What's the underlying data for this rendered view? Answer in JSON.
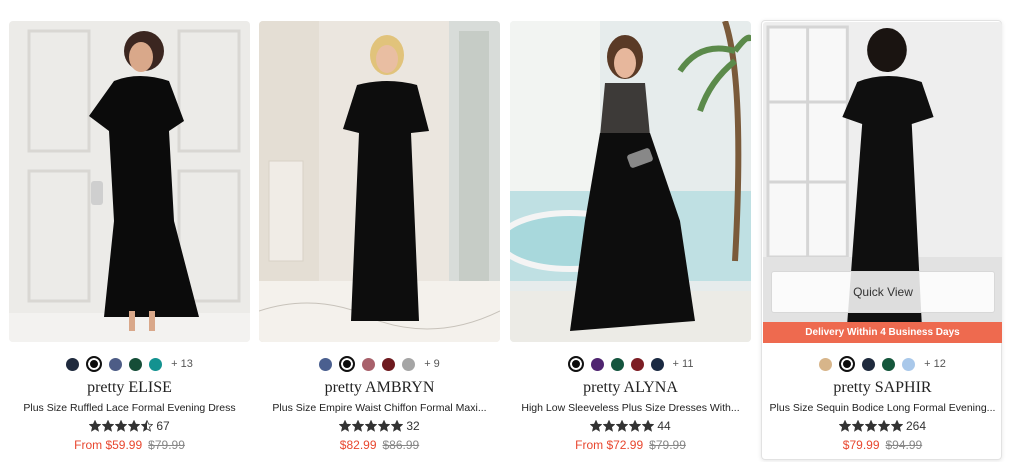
{
  "products": [
    {
      "brand": "pretty ELISE",
      "name": "Plus Size Ruffled Lace Formal Evening Dress",
      "rating": 4.5,
      "reviews": "67",
      "price": "From $59.99",
      "original_price": "$79.99",
      "swatches": [
        "#1f2a3d",
        "#0b0b0b",
        "#4d5c86",
        "#154d37",
        "#139290"
      ],
      "selected_swatch": 1,
      "more_colors": "+ 13",
      "image": {
        "dress_color": "#0b0b0b",
        "background": "#eceae7"
      }
    },
    {
      "brand": "pretty AMBRYN",
      "name": "Plus Size Empire Waist Chiffon Formal Maxi...",
      "rating": 5,
      "reviews": "32",
      "price": "$82.99",
      "original_price": "$86.99",
      "swatches": [
        "#4a5f8f",
        "#0b0b0b",
        "#a8616b",
        "#6e1a1f",
        "#a5a5a5"
      ],
      "selected_swatch": 1,
      "more_colors": "+ 9",
      "image": {
        "dress_color": "#0d0d0d",
        "background": "#ebe6df"
      }
    },
    {
      "brand": "pretty ALYNA",
      "name": "High Low Sleeveless Plus Size Dresses With...",
      "rating": 5,
      "reviews": "44",
      "price": "From $72.99",
      "original_price": "$79.99",
      "swatches": [
        "#0b0b0b",
        "#4f2470",
        "#14553e",
        "#7c1d24",
        "#1b2a42"
      ],
      "selected_swatch": 0,
      "more_colors": "+ 11",
      "image": {
        "dress_color": "#0d0d0d",
        "background": "#dfe9ea"
      }
    },
    {
      "brand": "pretty SAPHIR",
      "name": "Plus Size Sequin Bodice Long Formal Evening...",
      "rating": 5,
      "reviews": "264",
      "price": "$79.99",
      "original_price": "$94.99",
      "swatches": [
        "#d7b58a",
        "#0b0b0b",
        "#1f2a3d",
        "#15573c",
        "#a9c8ea"
      ],
      "selected_swatch": 1,
      "more_colors": "+ 12",
      "image": {
        "dress_color": "#0f0f0f",
        "background": "#eeeeee"
      },
      "quick_view": "Quick View",
      "delivery": "Delivery Within 4 Business Days"
    }
  ],
  "colors": {
    "price": "#e8472f",
    "delivery_bar": "#ee6a4f",
    "star": "#333333"
  }
}
